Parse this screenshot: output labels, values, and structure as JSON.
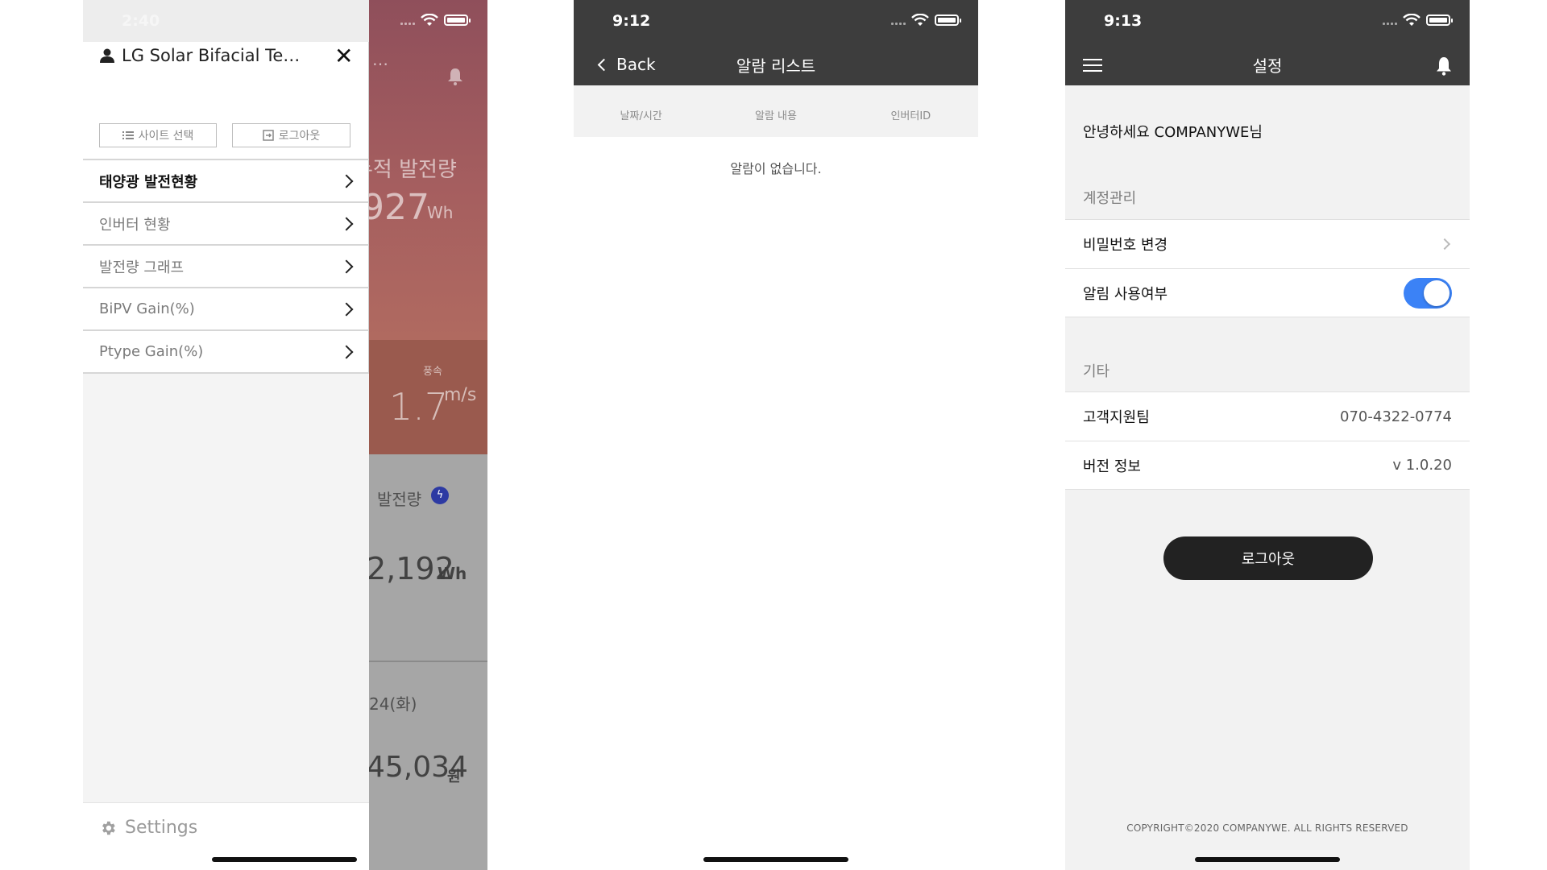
{
  "screen1": {
    "status_time": "2:40",
    "background": {
      "top_text": "d …",
      "cumulative_label": "누적 발전량",
      "cumulative_value": "927",
      "cumulative_unit": "Wh",
      "wind_label": "풍속",
      "wind_value": "1.7",
      "wind_unit": "m/s",
      "gen_label": "발전량",
      "gen_value": "2,192",
      "gen_unit": "Wh",
      "date_text": "24(화)",
      "money_value": "45,034",
      "money_unit": "원"
    },
    "drawer": {
      "title": "LG Solar Bifacial Te…",
      "site_select_label": "사이트 선택",
      "logout_label": "로그아웃",
      "menu": [
        {
          "label": "태양광 발전현황",
          "active": true
        },
        {
          "label": "인버터 현황",
          "active": false
        },
        {
          "label": "발전량 그래프",
          "active": false
        },
        {
          "label": "BiPV Gain(%)",
          "active": false
        },
        {
          "label": "Ptype Gain(%)",
          "active": false
        }
      ],
      "settings_label": "Settings"
    }
  },
  "screen2": {
    "status_time": "9:12",
    "back_label": "Back",
    "title": "알람 리스트",
    "columns": [
      "날짜/시간",
      "알람 내용",
      "인버터ID"
    ],
    "empty_message": "알람이 없습니다."
  },
  "screen3": {
    "status_time": "9:13",
    "title": "설정",
    "greeting": "안녕하세요 COMPANYWE님",
    "account_section": "계정관리",
    "change_password": "비밀번호 변경",
    "notification_label": "알림 사용여부",
    "notification_enabled": true,
    "etc_section": "기타",
    "support_label": "고객지원팀",
    "support_phone": "070-4322-0774",
    "version_label": "버전 정보",
    "version_value": "v 1.0.20",
    "logout_label": "로그아웃",
    "copyright": "COPYRIGHT©2020 COMPANYWE. ALL RIGHTS RESERVED"
  },
  "colors": {
    "navbar": "#3d3d3d",
    "toggle_on": "#3b82f6",
    "logout_button": "#222222"
  }
}
